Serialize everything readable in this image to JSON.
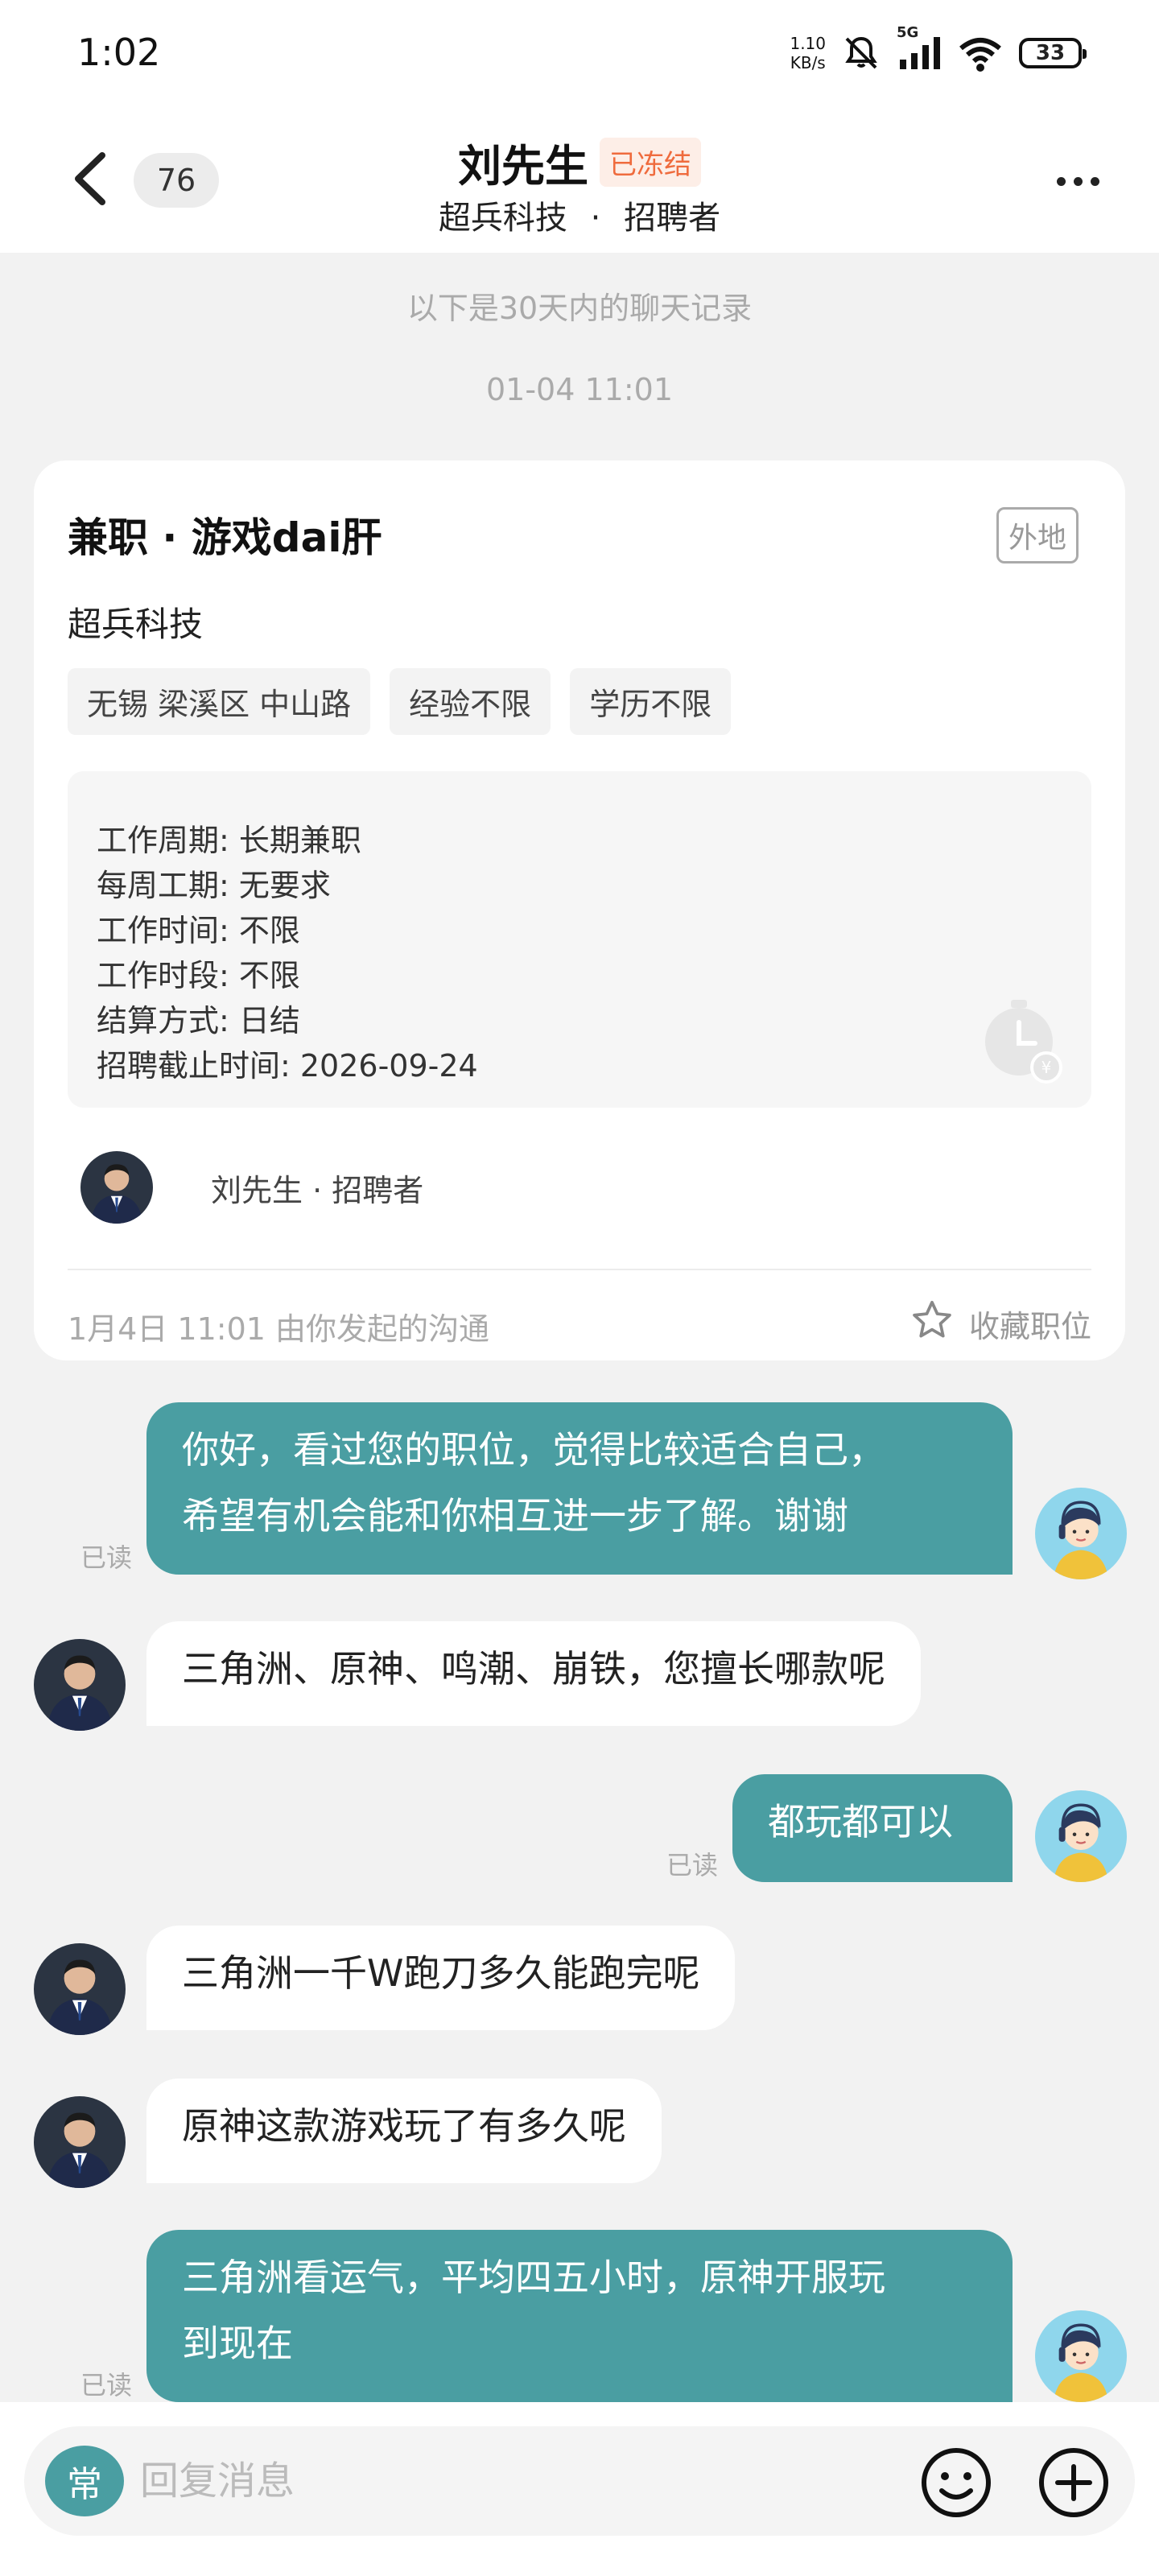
{
  "status_bar": {
    "time": "1:02",
    "net_speed_value": "1.10",
    "net_speed_unit": "KB/s",
    "network_type": "5G",
    "battery": "33",
    "icons": [
      "mute-bell-icon",
      "signal-icon",
      "wifi-icon",
      "battery-icon"
    ]
  },
  "header": {
    "back_icon": "chevron-left-icon",
    "unread_count": "76",
    "contact_name": "刘先生",
    "frozen_tag": "已冻结",
    "company": "超兵科技",
    "separator": "·",
    "role": "招聘者",
    "more_icon": "more-dots-icon"
  },
  "notices": {
    "history": "以下是30天内的聊天记录",
    "timestamp": "01-04 11:01"
  },
  "job_card": {
    "title": "兼职 · 游戏dai肝",
    "location_tag": "外地",
    "company": "超兵科技",
    "tags": [
      "无锡 梁溪区 中山路",
      "经验不限",
      "学历不限"
    ],
    "details": [
      "工作周期: 长期兼职",
      "每周工期: 无要求",
      "工作时间: 不限",
      "工作时段: 不限",
      "结算方式: 日结",
      "招聘截止时间: 2026-09-24"
    ],
    "recruiter": "刘先生  ·  招聘者",
    "footer": "1月4日 11:01 由你发起的沟通",
    "favorite_label": "收藏职位",
    "favorite_icon": "star-outline-icon"
  },
  "messages": [
    {
      "from": "me",
      "text": "你好，看过您的职位，觉得比较适合自己，希望有机会能和你相互进一步了解。谢谢",
      "lines": [
        "你好，看过您的职位，觉得比较适合自己，",
        "希望有机会能和你相互进一步了解。谢谢"
      ],
      "status": "已读"
    },
    {
      "from": "them",
      "text": "三角洲、原神、鸣潮、崩铁，您擅长哪款呢"
    },
    {
      "from": "me",
      "text": "都玩都可以",
      "status": "已读"
    },
    {
      "from": "them",
      "text": "三角洲一千W跑刀多久能跑完呢"
    },
    {
      "from": "them",
      "text": "原神这款游戏玩了有多久呢"
    },
    {
      "from": "me",
      "text": "三角洲看运气，平均四五小时，原神开服玩到现在",
      "lines": [
        "三角洲看运气，平均四五小时，原神开服玩",
        "到现在"
      ],
      "status": "已读"
    }
  ],
  "input_bar": {
    "quick_reply_label": "常",
    "placeholder": "回复消息",
    "emoji_icon": "smiley-icon",
    "plus_icon": "plus-circle-icon"
  },
  "colors": {
    "accent": "#4a9ea2",
    "frozen_text": "#ef6b3d",
    "frozen_bg": "#fdeee7",
    "background": "#f2f2f2"
  }
}
